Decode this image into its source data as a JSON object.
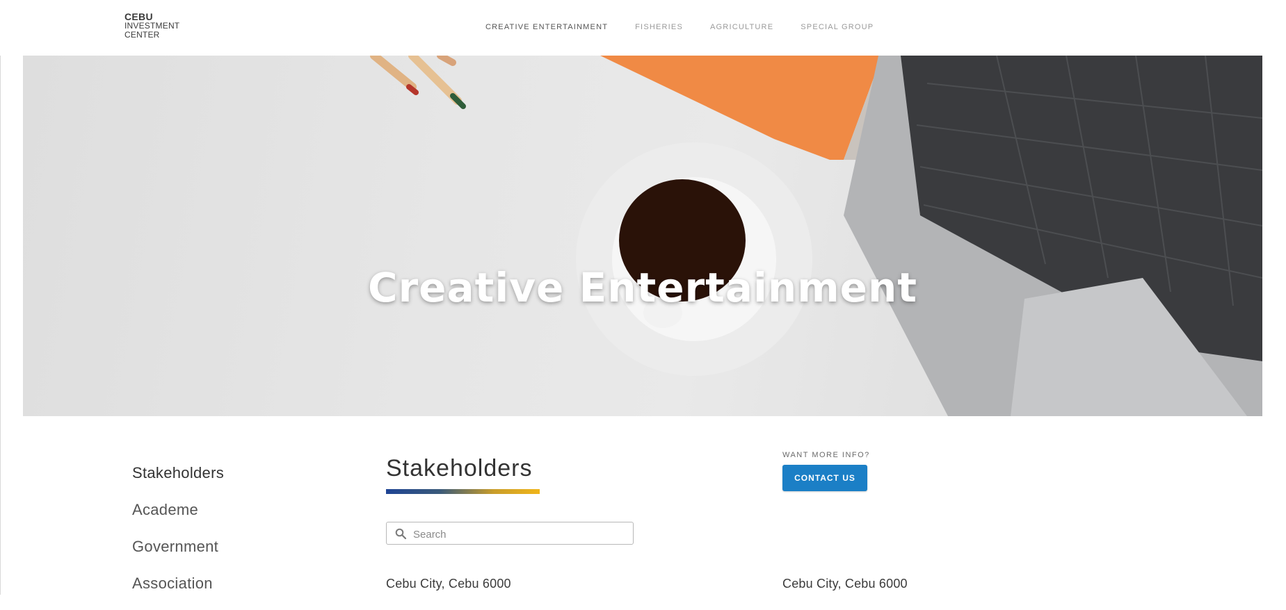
{
  "brand": {
    "line1": "CEBU",
    "line2": "INVESTMENT",
    "line3": "CENTER"
  },
  "nav": {
    "items": [
      {
        "label": "CREATIVE ENTERTAINMENT",
        "active": true
      },
      {
        "label": "FISHERIES",
        "active": false
      },
      {
        "label": "AGRICULTURE",
        "active": false
      },
      {
        "label": "SPECIAL GROUP",
        "active": false
      }
    ]
  },
  "hero": {
    "title": "Creative Entertainment"
  },
  "sidebar": {
    "items": [
      {
        "label": "Stakeholders"
      },
      {
        "label": "Academe"
      },
      {
        "label": "Government"
      },
      {
        "label": "Association"
      }
    ]
  },
  "main": {
    "title": "Stakeholders",
    "search_placeholder": "Search",
    "address_left": "Cebu City, Cebu 6000",
    "address_right": "Cebu City, Cebu 6000"
  },
  "info": {
    "label": "WANT MORE INFO?",
    "button": "CONTACT US"
  },
  "colors": {
    "accent": "#1b7fc6",
    "bar_start": "#1e4494",
    "bar_end": "#f0b51a"
  }
}
